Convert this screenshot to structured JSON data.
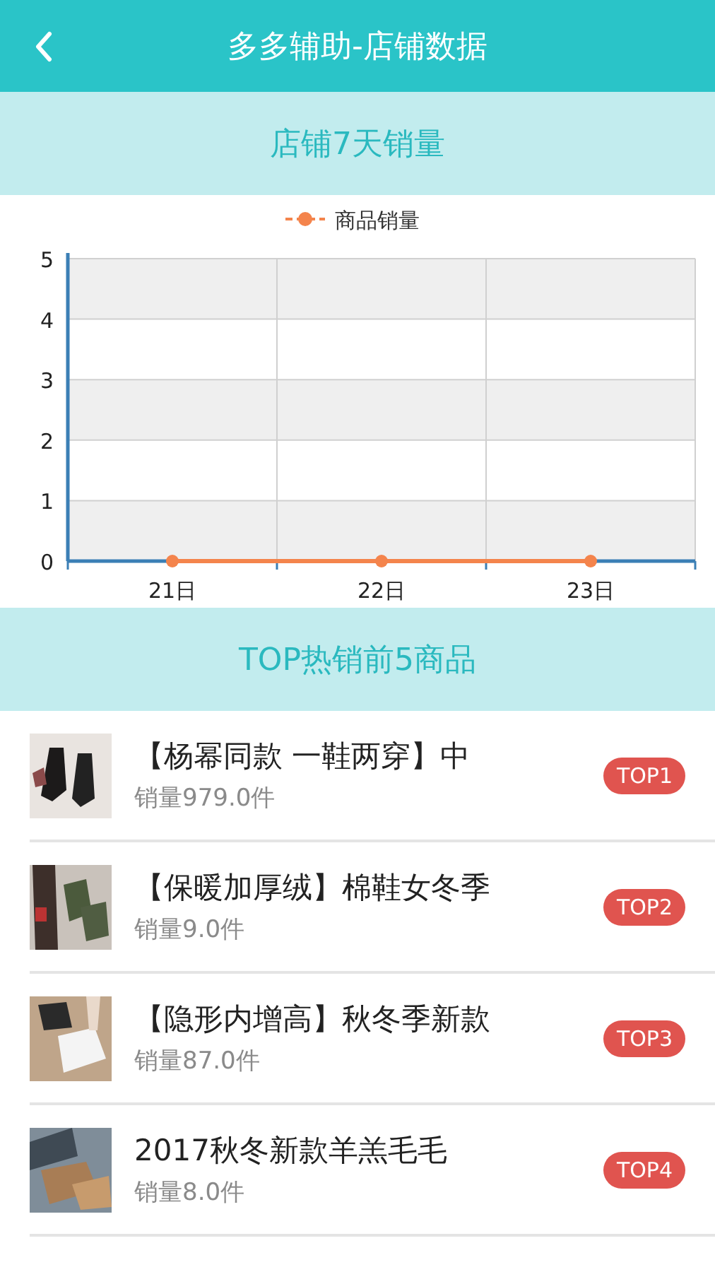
{
  "header": {
    "title": "多多辅助-店铺数据"
  },
  "sales_section": {
    "title": "店铺7天销量",
    "chart_data": {
      "type": "line",
      "categories": [
        "21日",
        "22日",
        "23日"
      ],
      "series": [
        {
          "name": "商品销量",
          "color": "#f4844c",
          "marker": "circle",
          "values": [
            0,
            0,
            0
          ]
        }
      ],
      "grid": true,
      "ylim": [
        0,
        5
      ],
      "yticks": [
        0,
        1,
        2,
        3,
        4,
        5
      ]
    }
  },
  "top_section": {
    "title": "TOP热销前5商品"
  },
  "products": [
    {
      "title": "【杨幂同款 一鞋两穿】中",
      "sales": "销量979.0件",
      "rank": "TOP1"
    },
    {
      "title": "【保暖加厚绒】棉鞋女冬季",
      "sales": "销量9.0件",
      "rank": "TOP2"
    },
    {
      "title": "【隐形内增高】秋冬季新款",
      "sales": "销量87.0件",
      "rank": "TOP3"
    },
    {
      "title": "2017秋冬新款羊羔毛毛",
      "sales": "销量8.0件",
      "rank": "TOP4"
    }
  ]
}
